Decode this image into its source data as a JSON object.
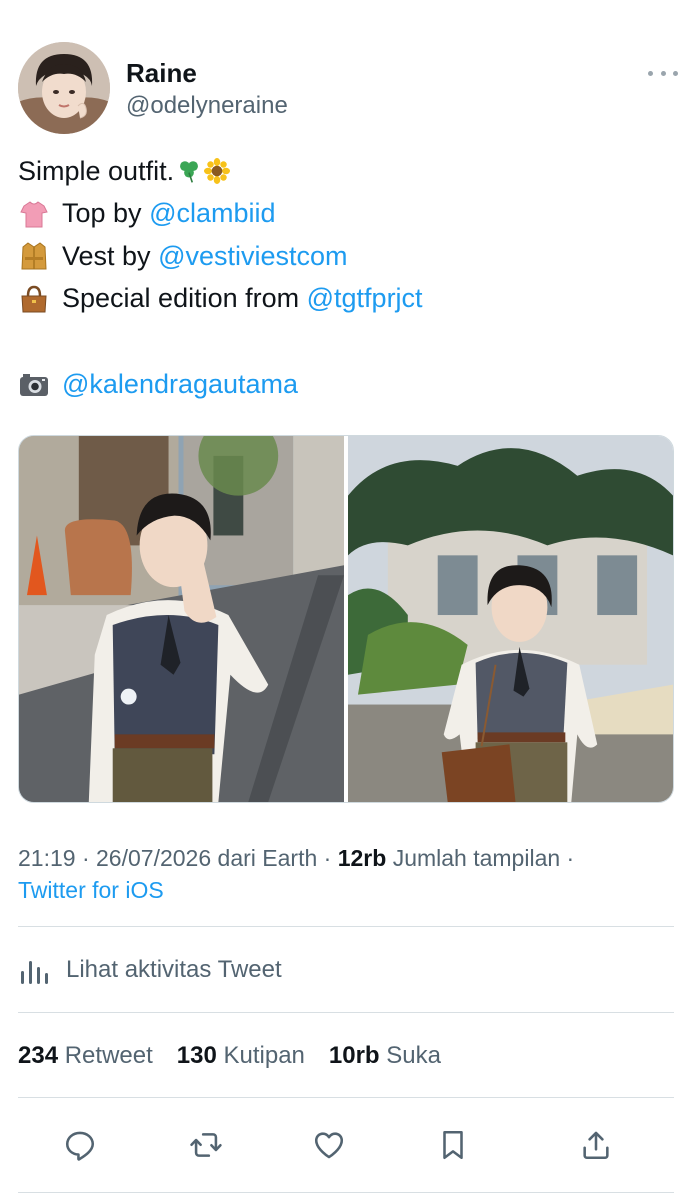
{
  "user": {
    "display_name": "Raine",
    "handle": "@odelyneraine"
  },
  "icons": {
    "more": "more-horizontal-icon",
    "activity": "bar-chart-icon",
    "reply": "reply-icon",
    "retweet": "retweet-icon",
    "like": "heart-icon",
    "bookmark": "bookmark-icon",
    "share": "share-icon"
  },
  "tweet": {
    "line1": "Simple outfit.",
    "line1_emojis": [
      "shamrock-emoji",
      "sunflower-emoji"
    ],
    "line2_prefix": "Top by ",
    "line2_mention": "@clambiid",
    "line2_emoji": "tshirt-emoji",
    "line3_prefix": "Vest by ",
    "line3_mention": "@vestiviestcom",
    "line3_emoji": "coat-emoji",
    "line4_prefix": "Special edition from ",
    "line4_mention": "@tgtfprjct",
    "line4_emoji": "handbag-emoji",
    "line5_mention": "@kalendragautama",
    "line5_emoji": "camera-emoji"
  },
  "media": {
    "count": 2
  },
  "meta": {
    "time": "21:19",
    "date": "26/07/2026",
    "location": "dari Earth",
    "views_count": "12rb",
    "views_label": "Jumlah tampilan",
    "separator": "·",
    "client": "Twitter for iOS"
  },
  "activity_label": "Lihat aktivitas Tweet",
  "stats": {
    "retweets_count": "234",
    "retweets_label": "Retweet",
    "quotes_count": "130",
    "quotes_label": "Kutipan",
    "likes_count": "10rb",
    "likes_label": "Suka"
  },
  "colors": {
    "link": "#1d9bf0",
    "text": "#0f1419",
    "secondary": "#536471",
    "divider": "#d8dfe3"
  }
}
